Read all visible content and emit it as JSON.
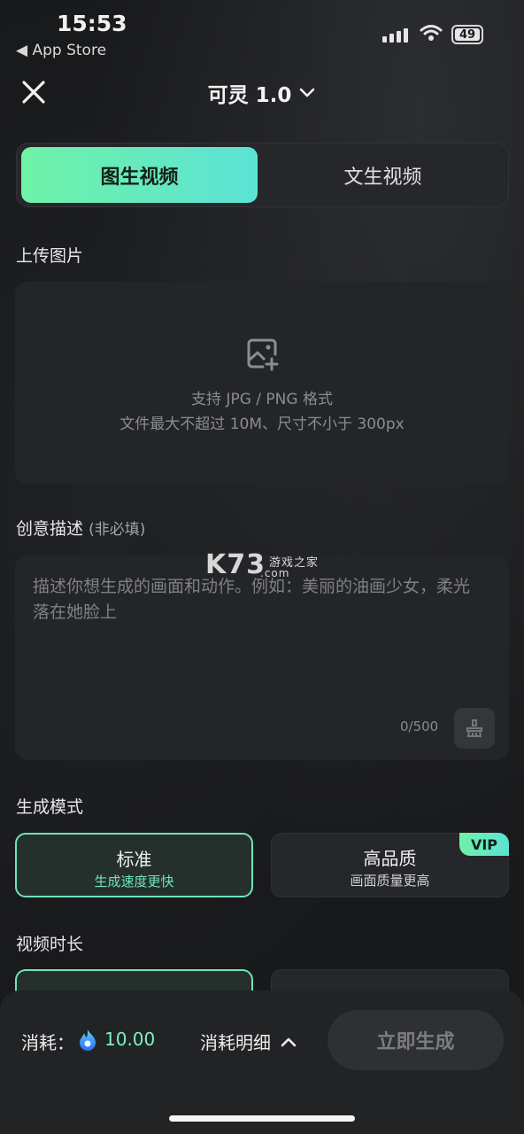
{
  "status_bar": {
    "time": "15:53",
    "back_app": "◀ App Store",
    "battery": "49"
  },
  "header": {
    "title": "可灵 1.0"
  },
  "tabs": [
    {
      "label": "图生视频",
      "active": true
    },
    {
      "label": "文生视频",
      "active": false
    }
  ],
  "upload": {
    "label": "上传图片",
    "hint_line1": "支持 JPG / PNG 格式",
    "hint_line2": "文件最大不超过 10M、尺寸不小于 300px"
  },
  "prompt": {
    "label": "创意描述",
    "optional": "(非必填)",
    "placeholder": "描述你想生成的画面和动作。例如：美丽的油画少女，柔光落在她脸上",
    "counter": "0/500"
  },
  "watermark": {
    "logo": "K73",
    "site": "游戏之家",
    "domain": ".com"
  },
  "mode": {
    "label": "生成模式",
    "options": [
      {
        "title": "标准",
        "subtitle": "生成速度更快",
        "selected": true
      },
      {
        "title": "高品质",
        "subtitle": "画面质量更高",
        "badge": "VIP",
        "selected": false
      }
    ]
  },
  "duration": {
    "label": "视频时长"
  },
  "bottom": {
    "cost_label": "消耗：",
    "cost_value": "10.00",
    "detail_label": "消耗明细",
    "generate_label": "立即生成"
  },
  "colors": {
    "accent_start": "#6ef2a6",
    "accent_end": "#5ce2d6",
    "background": "#18191b"
  }
}
